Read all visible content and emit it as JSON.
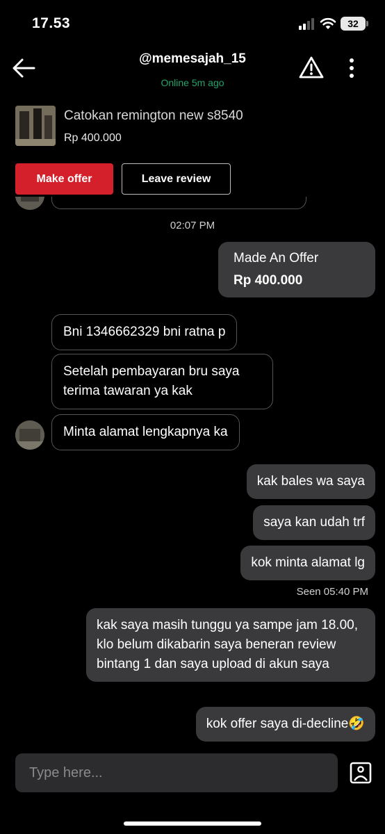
{
  "status_bar": {
    "time": "17.53",
    "battery": "32"
  },
  "header": {
    "title": "@memesajah_15",
    "status": "Online 5m ago"
  },
  "product": {
    "name": "Catokan remington new s8540",
    "price": "Rp 400.000"
  },
  "actions": {
    "offer_label": "Make offer",
    "review_label": "Leave review"
  },
  "chat": {
    "time_1": "02:07 PM",
    "offer": {
      "title": "Made An Offer",
      "amount": "Rp 400.000"
    },
    "incoming": [
      "Bni 1346662329 bni ratna p",
      "Setelah pembayaran bru saya terima tawaran ya kak",
      "Minta alamat lengkapnya ka"
    ],
    "outgoing": [
      "kak bales wa saya",
      "saya kan udah trf",
      "kok minta alamat lg",
      "kak saya masih tunggu ya sampe jam 18.00, klo belum dikabarin saya beneran review bintang 1 dan saya upload di akun saya",
      "kok offer saya di-decline🤣"
    ],
    "seen": "Seen 05:40 PM"
  },
  "composer": {
    "placeholder": "Type here..."
  },
  "colors": {
    "accent_red": "#d4202a",
    "online_green": "#23a46b",
    "bubble_out": "#3a3a3c"
  }
}
